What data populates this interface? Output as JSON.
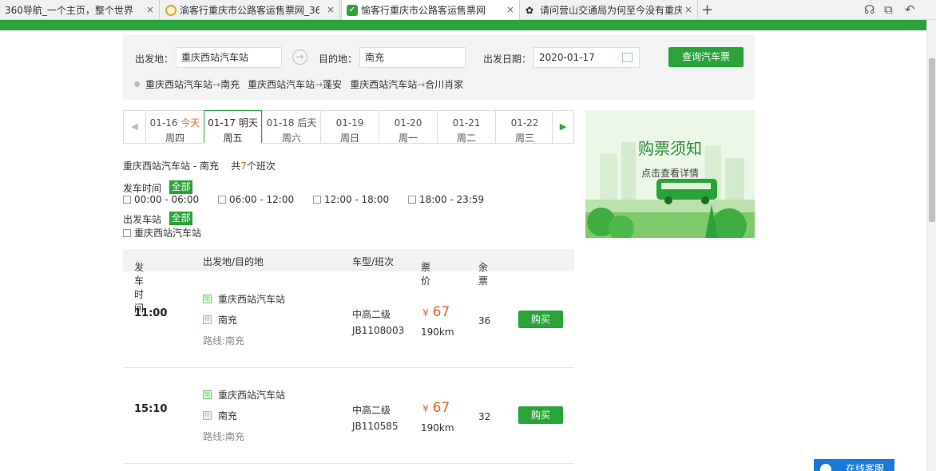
{
  "browser": {
    "tabs": [
      {
        "title": "360导航_一个主页，整个世界"
      },
      {
        "title": "渝客行重庆市公路客运售票网_36"
      },
      {
        "title": "愉客行重庆市公路客运售票网"
      },
      {
        "title": "请问营山交通局为何至今没有重庆"
      }
    ],
    "new_tab": "+",
    "close": "×"
  },
  "search": {
    "from_label": "出发地：",
    "from_value": "重庆西站汽车站",
    "to_label": "目的地：",
    "to_value": "南充",
    "date_label": "出发日期：",
    "date_value": "2020-01-17",
    "query_button": "查询汽车票",
    "history": [
      {
        "from": "重庆西站汽车站",
        "arrow": "→",
        "to": "南充"
      },
      {
        "from": "重庆西站汽车站",
        "arrow": "→",
        "to": "蓬安"
      },
      {
        "from": "重庆西站汽车站",
        "arrow": "→",
        "to": "合川肖家"
      }
    ]
  },
  "dates": [
    {
      "date": "01-16",
      "rel": "今天",
      "weekday": "周四"
    },
    {
      "date": "01-17",
      "rel": "明天",
      "weekday": "周五"
    },
    {
      "date": "01-18",
      "rel": "后天",
      "weekday": "周六"
    },
    {
      "date": "01-19",
      "rel": "",
      "weekday": "周日"
    },
    {
      "date": "01-20",
      "rel": "",
      "weekday": "周一"
    },
    {
      "date": "01-21",
      "rel": "",
      "weekday": "周二"
    },
    {
      "date": "01-22",
      "rel": "",
      "weekday": "周三"
    }
  ],
  "selected_date_index": 1,
  "banner": {
    "title": "购票须知",
    "subtitle": "点击查看详情"
  },
  "summary": {
    "route": "重庆西站汽车站 - 南充",
    "count_prefix": "共",
    "count": "7",
    "count_suffix": "个班次"
  },
  "filters": {
    "time_label": "发车时间",
    "all": "全部",
    "time_options": [
      "00:00 - 06:00",
      "06:00 - 12:00",
      "12:00 - 18:00",
      "18:00 - 23:59"
    ],
    "station_label": "出发车站",
    "station_options": [
      "重庆西站汽车站"
    ]
  },
  "table": {
    "headers": {
      "time": "发车时间",
      "route": "出发地/目的地",
      "type": "车型/班次",
      "price": "票价",
      "left": "余票"
    },
    "rows": [
      {
        "time": "11:00",
        "from": "重庆西站汽车站",
        "to": "南充",
        "via": "路线:南充",
        "class": "中高二级",
        "code": "JB1108003",
        "price": "67",
        "yen": "¥",
        "km": "190km",
        "left": "36",
        "buy": "购买"
      },
      {
        "time": "15:10",
        "from": "重庆西站汽车站",
        "to": "南充",
        "via": "路线:南充",
        "class": "中高二级",
        "code": "JB110585",
        "price": "67",
        "yen": "¥",
        "km": "190km",
        "left": "32",
        "buy": "购买"
      }
    ]
  },
  "service": {
    "label": "在线客服"
  },
  "colors": {
    "brand_green": "#2aa33a",
    "price_orange": "#e8642c"
  }
}
